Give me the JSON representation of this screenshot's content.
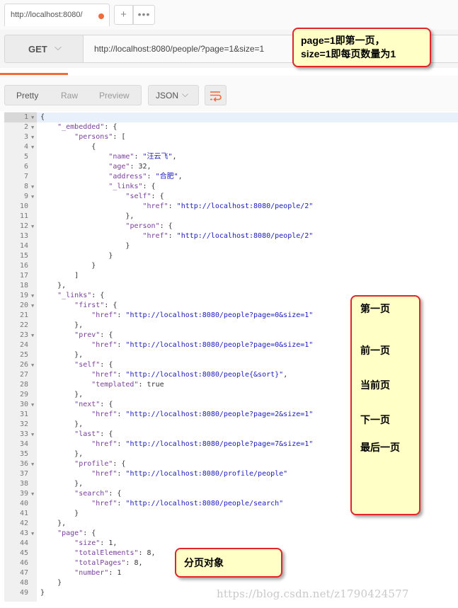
{
  "tab": {
    "title": "http://localhost:8080/",
    "add_icon": "+",
    "more_icon": "•••"
  },
  "request": {
    "method": "GET",
    "url": "http://localhost:8080/people/?page=1&size=1"
  },
  "response_toolbar": {
    "views": [
      "Pretty",
      "Raw",
      "Preview"
    ],
    "format": "JSON"
  },
  "code_lines": [
    {
      "n": "1",
      "t": "{"
    },
    {
      "n": "2",
      "t": "    \"_embedded\": {"
    },
    {
      "n": "3",
      "t": "        \"persons\": ["
    },
    {
      "n": "4",
      "t": "            {"
    },
    {
      "n": "5",
      "t": "                \"name\": \"汪云飞\","
    },
    {
      "n": "6",
      "t": "                \"age\": 32,"
    },
    {
      "n": "7",
      "t": "                \"address\": \"合肥\","
    },
    {
      "n": "8",
      "t": "                \"_links\": {"
    },
    {
      "n": "9",
      "t": "                    \"self\": {"
    },
    {
      "n": "10",
      "t": "                        \"href\": \"http://localhost:8080/people/2\""
    },
    {
      "n": "11",
      "t": "                    },"
    },
    {
      "n": "12",
      "t": "                    \"person\": {"
    },
    {
      "n": "13",
      "t": "                        \"href\": \"http://localhost:8080/people/2\""
    },
    {
      "n": "14",
      "t": "                    }"
    },
    {
      "n": "15",
      "t": "                }"
    },
    {
      "n": "16",
      "t": "            }"
    },
    {
      "n": "17",
      "t": "        ]"
    },
    {
      "n": "18",
      "t": "    },"
    },
    {
      "n": "19",
      "t": "    \"_links\": {"
    },
    {
      "n": "20",
      "t": "        \"first\": {"
    },
    {
      "n": "21",
      "t": "            \"href\": \"http://localhost:8080/people?page=0&size=1\""
    },
    {
      "n": "22",
      "t": "        },"
    },
    {
      "n": "23",
      "t": "        \"prev\": {"
    },
    {
      "n": "24",
      "t": "            \"href\": \"http://localhost:8080/people?page=0&size=1\""
    },
    {
      "n": "25",
      "t": "        },"
    },
    {
      "n": "26",
      "t": "        \"self\": {"
    },
    {
      "n": "27",
      "t": "            \"href\": \"http://localhost:8080/people{&sort}\","
    },
    {
      "n": "28",
      "t": "            \"templated\": true"
    },
    {
      "n": "29",
      "t": "        },"
    },
    {
      "n": "30",
      "t": "        \"next\": {"
    },
    {
      "n": "31",
      "t": "            \"href\": \"http://localhost:8080/people?page=2&size=1\""
    },
    {
      "n": "32",
      "t": "        },"
    },
    {
      "n": "33",
      "t": "        \"last\": {"
    },
    {
      "n": "34",
      "t": "            \"href\": \"http://localhost:8080/people?page=7&size=1\""
    },
    {
      "n": "35",
      "t": "        },"
    },
    {
      "n": "36",
      "t": "        \"profile\": {"
    },
    {
      "n": "37",
      "t": "            \"href\": \"http://localhost:8080/profile/people\""
    },
    {
      "n": "38",
      "t": "        },"
    },
    {
      "n": "39",
      "t": "        \"search\": {"
    },
    {
      "n": "40",
      "t": "            \"href\": \"http://localhost:8080/people/search\""
    },
    {
      "n": "41",
      "t": "        }"
    },
    {
      "n": "42",
      "t": "    },"
    },
    {
      "n": "43",
      "t": "    \"page\": {"
    },
    {
      "n": "44",
      "t": "        \"size\": 1,"
    },
    {
      "n": "45",
      "t": "        \"totalElements\": 8,"
    },
    {
      "n": "46",
      "t": "        \"totalPages\": 8,"
    },
    {
      "n": "47",
      "t": "        \"number\": 1"
    },
    {
      "n": "48",
      "t": "    }"
    },
    {
      "n": "49",
      "t": "}"
    }
  ],
  "fold_lines": [
    "1",
    "2",
    "3",
    "4",
    "8",
    "9",
    "12",
    "19",
    "20",
    "23",
    "26",
    "30",
    "33",
    "36",
    "39",
    "43"
  ],
  "annotations": {
    "pagination_note_line1": "page=1即第一页，",
    "pagination_note_line2": "size=1即每页数量为1",
    "links_labels": [
      "第一页",
      "前一页",
      "当前页",
      "下一页",
      "最后一页"
    ],
    "page_object_note": "分页对象"
  },
  "watermark": "https://blog.csdn.net/z1790424577",
  "colors": {
    "accent": "#f26b3a",
    "note_bg": "#ffffc6",
    "note_border": "#e0262b",
    "json_key": "#7a3e9d",
    "json_string": "#1b1bbf"
  }
}
